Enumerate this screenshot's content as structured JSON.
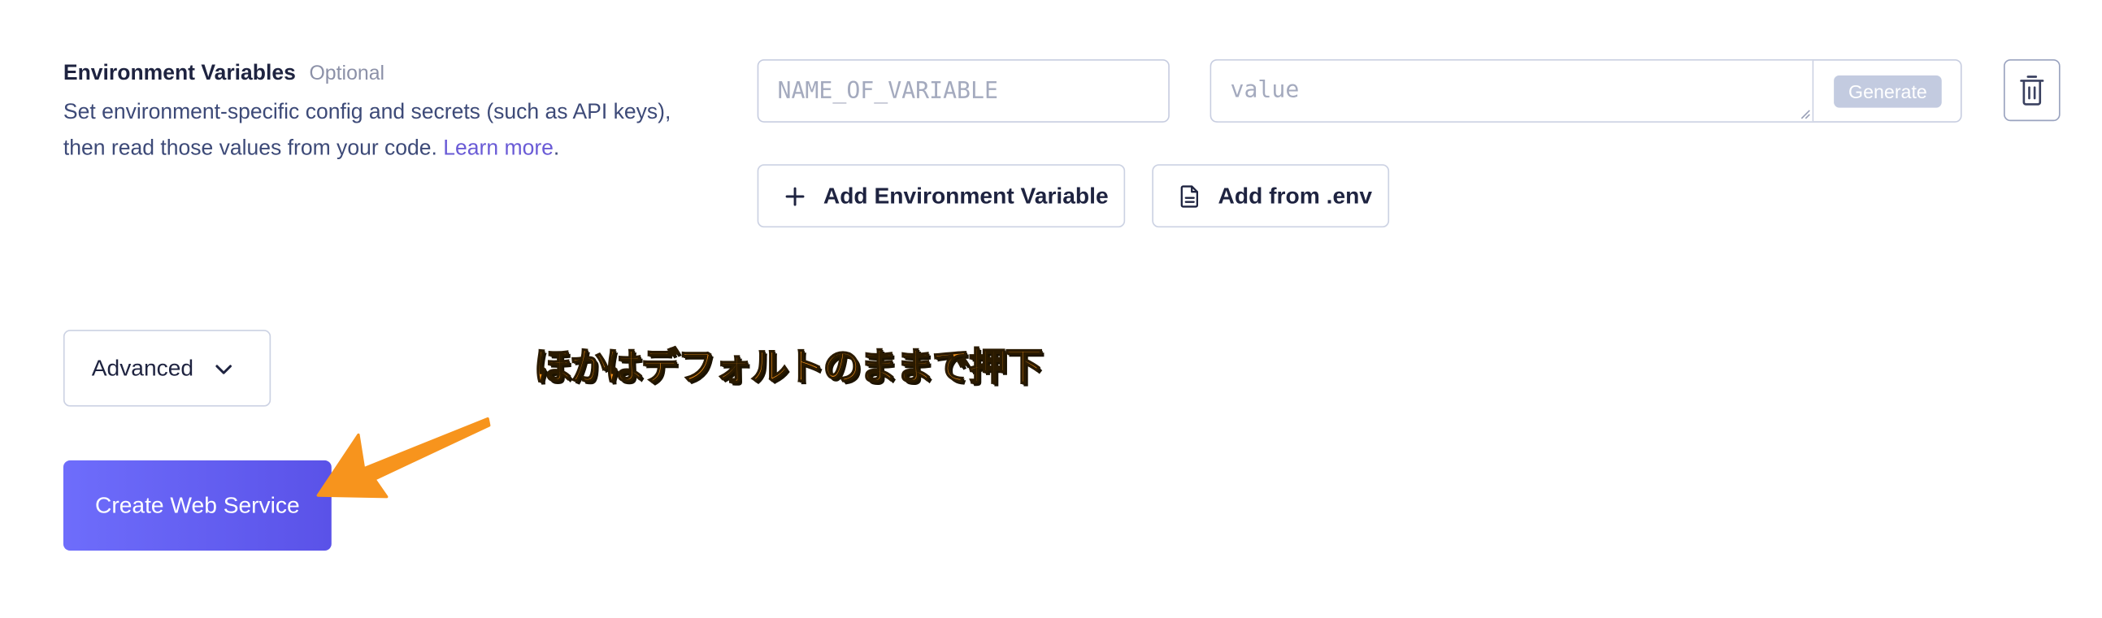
{
  "env_section": {
    "title": "Environment Variables",
    "optional_label": "Optional",
    "description": "Set environment-specific config and secrets (such as API keys), then read those values from your code. ",
    "learn_more": "Learn more",
    "period": ".",
    "name_placeholder": "NAME_OF_VARIABLE",
    "value_placeholder": "value",
    "generate_label": "Generate",
    "add_variable_label": "Add Environment Variable",
    "add_from_env_label": "Add from .env"
  },
  "advanced": {
    "label": "Advanced"
  },
  "submit": {
    "label": "Create Web Service"
  },
  "annotation": {
    "text": "ほかはデフォルトのままで押下",
    "color": "#f7941d"
  },
  "colors": {
    "primary_button": "#5f5bf0",
    "link": "#6a5bd6",
    "generate_disabled": "#c3cbe0"
  }
}
